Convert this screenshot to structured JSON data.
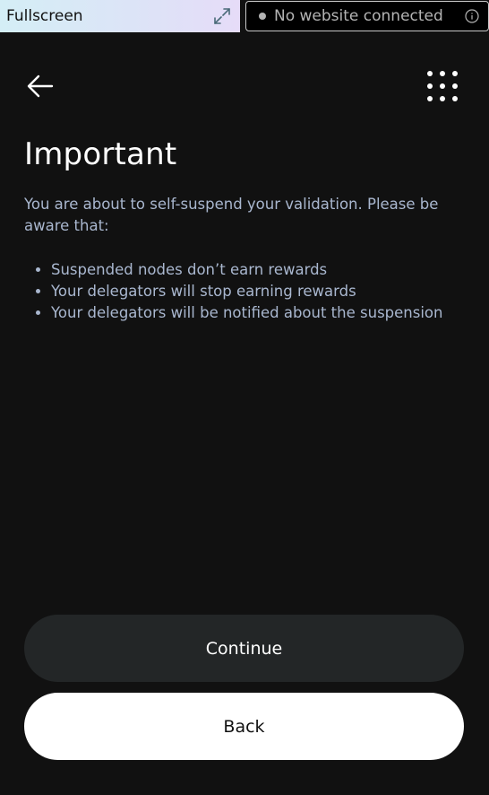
{
  "topbar": {
    "fullscreen_label": "Fullscreen",
    "expand_icon": "expand-arrows-icon",
    "connection_status": "No website connected",
    "info_icon": "info-icon"
  },
  "header": {
    "back_icon": "arrow-left-icon",
    "menu_icon": "grid-dots-icon"
  },
  "main": {
    "title": "Important",
    "intro": "You are about to self-suspend your validation. Please be aware that:",
    "bullets": [
      "Suspended nodes don’t earn rewards",
      "Your delegators will stop earning rewards",
      "Your delegators will be notified about the suspension"
    ]
  },
  "actions": {
    "continue_label": "Continue",
    "back_label": "Back"
  },
  "colors": {
    "background": "#111111",
    "text_muted": "#a9b7cf",
    "button_dark": "#232627",
    "button_light": "#ffffff"
  }
}
